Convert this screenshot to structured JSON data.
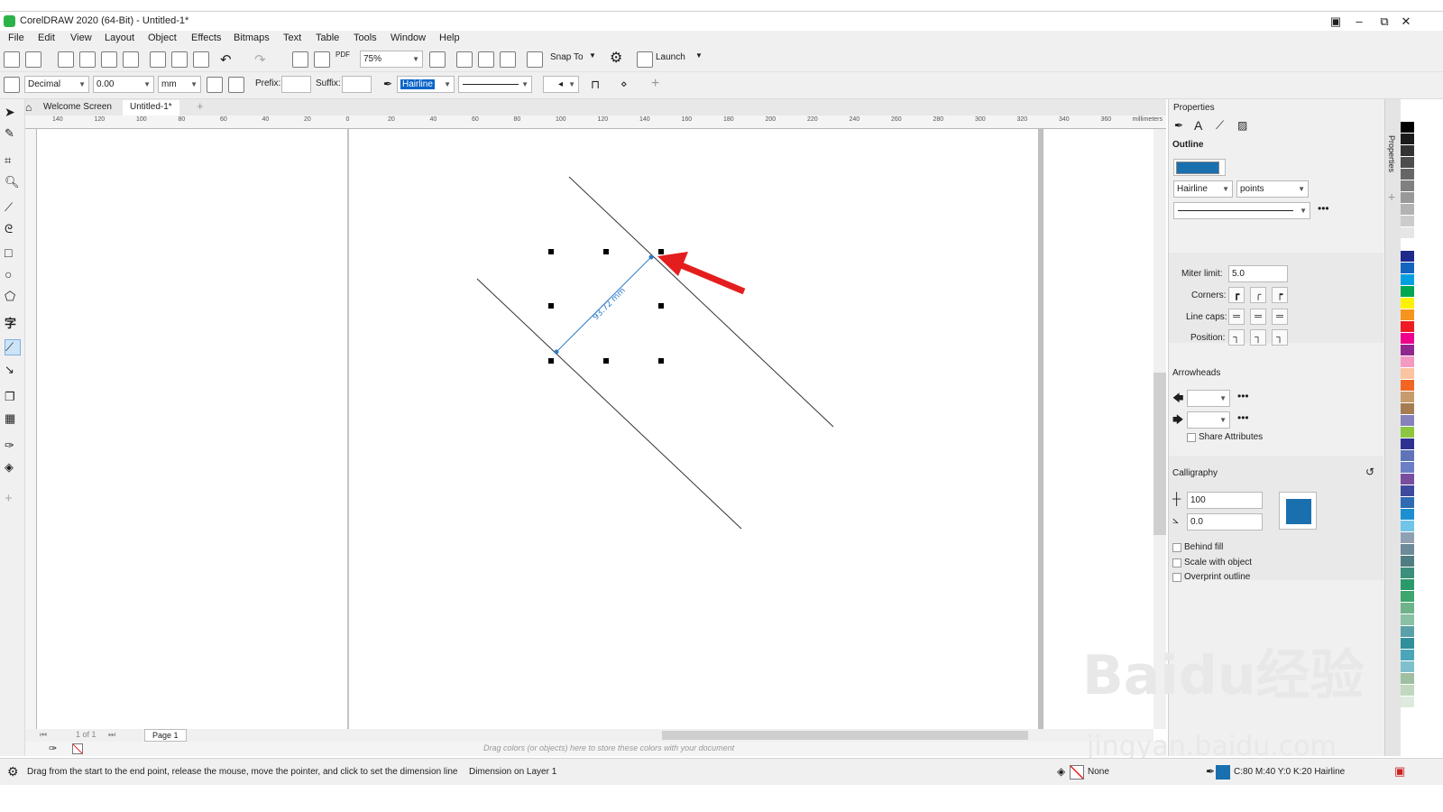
{
  "window": {
    "title": "CorelDRAW 2020 (64-Bit) - Untitled-1*"
  },
  "menu": [
    "File",
    "Edit",
    "View",
    "Layout",
    "Object",
    "Effects",
    "Bitmaps",
    "Text",
    "Table",
    "Tools",
    "Window",
    "Help"
  ],
  "toolbar": {
    "zoom": "75%",
    "snap_to": "Snap To",
    "launch": "Launch"
  },
  "propbar": {
    "units_format": "Decimal",
    "precision": "0.00",
    "units": "mm",
    "prefix_label": "Prefix:",
    "suffix_label": "Suffix:",
    "outline_width": "Hairline"
  },
  "tabs": {
    "welcome": "Welcome Screen",
    "doc": "Untitled-1*"
  },
  "ruler": {
    "h_labels": [
      "140",
      "120",
      "100",
      "80",
      "60",
      "40",
      "20",
      "0",
      "20",
      "40",
      "60",
      "80",
      "100",
      "120",
      "140",
      "160",
      "180",
      "200",
      "220",
      "240",
      "260",
      "280",
      "300",
      "320",
      "340",
      "360"
    ],
    "unit": "millimeters"
  },
  "pagenav": {
    "of": "1 of 1",
    "page": "Page 1"
  },
  "palette_hint": "Drag colors (or objects) here to store these colors with your document",
  "status": {
    "hint": "Drag from the start to the end point, release the mouse, move the pointer, and click to set the dimension line",
    "object": "Dimension on Layer 1",
    "fill": "None",
    "outline": "C:80 M:40 Y:0 K:20  Hairline"
  },
  "properties": {
    "title": "Properties",
    "outline_label": "Outline",
    "outline_color": "#1a6faf",
    "width": "Hairline",
    "width_unit": "points",
    "miter_label": "Miter limit:",
    "miter_value": "5.0",
    "corners_label": "Corners:",
    "linecaps_label": "Line caps:",
    "position_label": "Position:",
    "arrowheads_label": "Arrowheads",
    "share_attributes": "Share Attributes",
    "calligraphy_label": "Calligraphy",
    "stretch": "100",
    "angle": "0.0",
    "behind_fill": "Behind fill",
    "scale_with_object": "Scale with object",
    "overprint_outline": "Overprint outline",
    "dock_tab": "Properties"
  },
  "palette_colors": [
    "#000000",
    "#1a1a1a",
    "#333333",
    "#4d4d4d",
    "#666666",
    "#808080",
    "#999999",
    "#b3b3b3",
    "#cccccc",
    "#e6e6e6",
    "#ffffff",
    "#1f2a8c",
    "#1565c0",
    "#00a0e0",
    "#00a651",
    "#fff200",
    "#f7941d",
    "#ed1c24",
    "#ec008c",
    "#92278f",
    "#f49ac1",
    "#fbc4a0",
    "#f26522",
    "#c69c6d",
    "#a67c52",
    "#8781bd",
    "#8dc63f",
    "#2e3192",
    "#5f74b8",
    "#6b7fc7",
    "#7a4d9f",
    "#3f4a9e",
    "#2f6bb3",
    "#1b8fd1",
    "#70c5e8",
    "#8fa0b3",
    "#6d8a99",
    "#4f7d80",
    "#3c8f7a",
    "#2a9a6a",
    "#3fa56e",
    "#6fb38a",
    "#8ac0a5",
    "#5aa0a8",
    "#2f8f9a",
    "#4aa6b8",
    "#7fc0cc",
    "#9fbfa0",
    "#c0d8c0",
    "#dfeadf"
  ],
  "watermark": "Baidu经验",
  "watermark_url": "jingyan.baidu.com",
  "dimension_text": "93.72 mm"
}
